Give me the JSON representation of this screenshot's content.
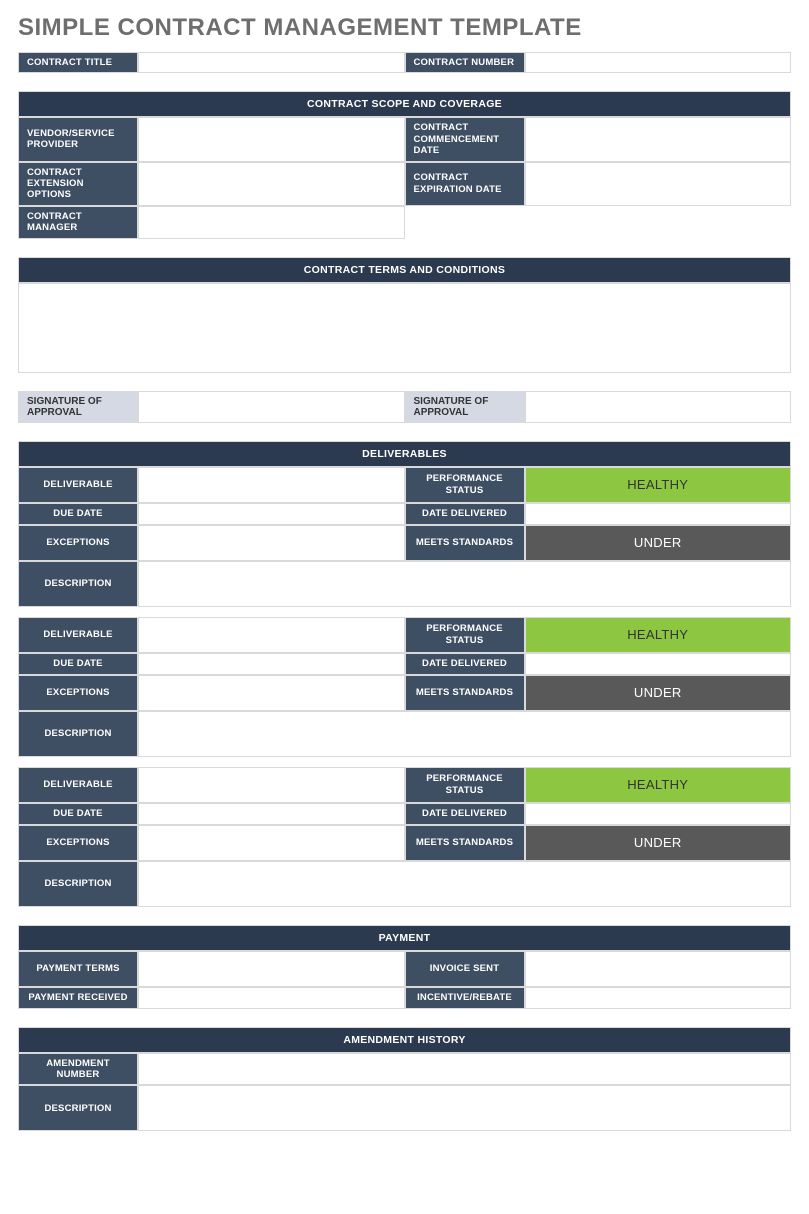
{
  "title": "SIMPLE CONTRACT MANAGEMENT TEMPLATE",
  "header": {
    "contract_title_lbl": "CONTRACT TITLE",
    "contract_title_val": "",
    "contract_number_lbl": "CONTRACT NUMBER",
    "contract_number_val": ""
  },
  "scope": {
    "section_title": "CONTRACT SCOPE AND COVERAGE",
    "vendor_lbl": "VENDOR/SERVICE PROVIDER",
    "vendor_val": "",
    "commencement_lbl": "CONTRACT COMMENCEMENT DATE",
    "commencement_val": "",
    "extension_lbl": "CONTRACT EXTENSION OPTIONS",
    "extension_val": "",
    "expiration_lbl": "CONTRACT EXPIRATION DATE",
    "expiration_val": "",
    "manager_lbl": "CONTRACT MANAGER",
    "manager_val": ""
  },
  "terms": {
    "section_title": "CONTRACT TERMS AND CONDITIONS",
    "body": ""
  },
  "signatures": {
    "sig1_lbl": "SIGNATURE OF APPROVAL",
    "sig1_val": "",
    "sig2_lbl": "SIGNATURE OF APPROVAL",
    "sig2_val": ""
  },
  "deliverables_section_title": "DELIVERABLES",
  "deliverable_labels": {
    "deliverable": "DELIVERABLE",
    "performance_status": "PERFORMANCE STATUS",
    "due_date": "DUE DATE",
    "date_delivered": "DATE DELIVERED",
    "exceptions": "EXCEPTIONS",
    "meets_standards": "MEETS STANDARDS",
    "description": "DESCRIPTION"
  },
  "deliverables": [
    {
      "deliverable": "",
      "performance_status": "HEALTHY",
      "due_date": "",
      "date_delivered": "",
      "exceptions": "",
      "meets_standards": "UNDER",
      "description": ""
    },
    {
      "deliverable": "",
      "performance_status": "HEALTHY",
      "due_date": "",
      "date_delivered": "",
      "exceptions": "",
      "meets_standards": "UNDER",
      "description": ""
    },
    {
      "deliverable": "",
      "performance_status": "HEALTHY",
      "due_date": "",
      "date_delivered": "",
      "exceptions": "",
      "meets_standards": "UNDER",
      "description": ""
    }
  ],
  "payment": {
    "section_title": "PAYMENT",
    "terms_lbl": "PAYMENT TERMS",
    "terms_val": "",
    "invoice_lbl": "INVOICE SENT",
    "invoice_val": "",
    "received_lbl": "PAYMENT RECEIVED",
    "received_val": "",
    "incentive_lbl": "INCENTIVE/REBATE",
    "incentive_val": ""
  },
  "amendment": {
    "section_title": "AMENDMENT HISTORY",
    "number_lbl": "AMENDMENT NUMBER",
    "number_val": "",
    "description_lbl": "DESCRIPTION",
    "description_val": ""
  }
}
